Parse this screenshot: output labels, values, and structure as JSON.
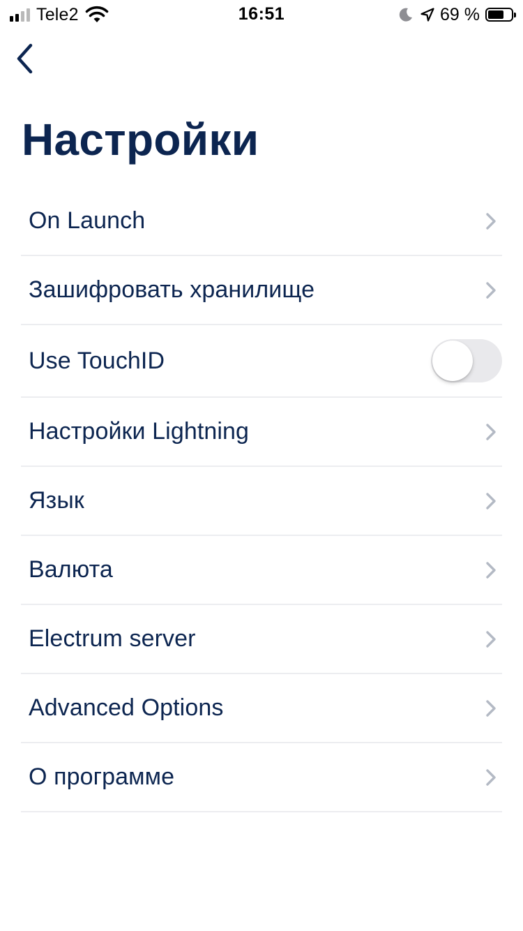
{
  "status_bar": {
    "carrier": "Tele2",
    "time": "16:51",
    "battery_percent": "69 %",
    "battery_level": 0.69,
    "icons": [
      "signal-icon",
      "wifi-icon",
      "moon-icon",
      "location-arrow-icon",
      "battery-icon"
    ]
  },
  "nav": {
    "back_icon": "chevron-left-icon"
  },
  "page": {
    "title": "Настройки"
  },
  "settings": {
    "items": [
      {
        "label": "On Launch",
        "control": "chevron"
      },
      {
        "label": "Зашифровать хранилище",
        "control": "chevron"
      },
      {
        "label": "Use TouchID",
        "control": "toggle",
        "value": false
      },
      {
        "label": "Настройки Lightning",
        "control": "chevron"
      },
      {
        "label": "Язык",
        "control": "chevron"
      },
      {
        "label": "Валюта",
        "control": "chevron"
      },
      {
        "label": "Electrum server",
        "control": "chevron"
      },
      {
        "label": "Advanced Options",
        "control": "chevron"
      },
      {
        "label": "О программе",
        "control": "chevron"
      }
    ]
  },
  "colors": {
    "text": "#0c2550",
    "separator": "#ecedf0",
    "chevron": "#b3b9c4",
    "toggle_off": "#e9e9ec"
  }
}
